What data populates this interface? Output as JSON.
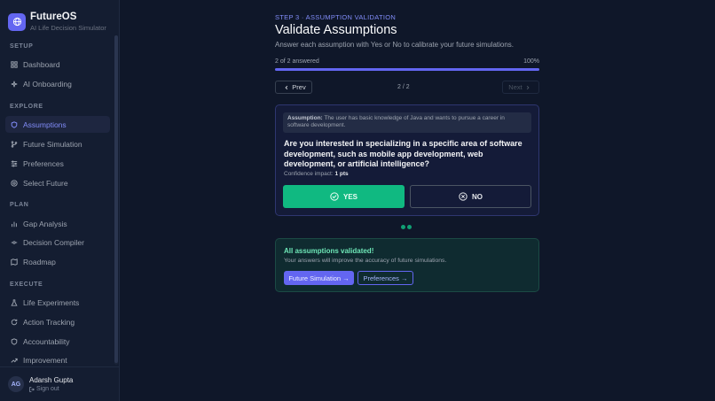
{
  "brand": {
    "name": "FutureOS",
    "subtitle": "AI Life Decision Simulator"
  },
  "sidebar": {
    "sections": [
      {
        "label": "SETUP",
        "items": [
          {
            "label": "Dashboard",
            "icon": "grid-icon"
          },
          {
            "label": "AI Onboarding",
            "icon": "sparkle-icon"
          }
        ]
      },
      {
        "label": "EXPLORE",
        "items": [
          {
            "label": "Assumptions",
            "icon": "shield-icon",
            "active": true
          },
          {
            "label": "Future Simulation",
            "icon": "branch-icon"
          },
          {
            "label": "Preferences",
            "icon": "sliders-icon"
          },
          {
            "label": "Select Future",
            "icon": "target-icon"
          }
        ]
      },
      {
        "label": "PLAN",
        "items": [
          {
            "label": "Gap Analysis",
            "icon": "bar-chart-icon"
          },
          {
            "label": "Decision Compiler",
            "icon": "compiler-icon"
          },
          {
            "label": "Roadmap",
            "icon": "map-icon"
          }
        ]
      },
      {
        "label": "EXECUTE",
        "items": [
          {
            "label": "Life Experiments",
            "icon": "flask-icon"
          },
          {
            "label": "Action Tracking",
            "icon": "refresh-icon"
          },
          {
            "label": "Accountability",
            "icon": "shield-outline-icon"
          },
          {
            "label": "Improvement",
            "icon": "trend-up-icon"
          }
        ]
      }
    ]
  },
  "user": {
    "initials": "AG",
    "name": "Adarsh Gupta",
    "signout": "Sign out"
  },
  "main": {
    "step": "STEP 3 · ASSUMPTION VALIDATION",
    "title": "Validate Assumptions",
    "subtitle": "Answer each assumption with Yes or No to calibrate your future simulations.",
    "progress": {
      "label": "2 of 2 answered",
      "percent_label": "100%",
      "fraction": 1.0
    },
    "nav": {
      "prev": "Prev",
      "page": "2 / 2",
      "next": "Next"
    },
    "card": {
      "assumption_label": "Assumption:",
      "assumption_text": "The user has basic knowledge of Java and wants to pursue a career in software development.",
      "question": "Are you interested in specializing in a specific area of software development, such as mobile app development, web development, or artificial intelligence?",
      "impact_label": "Confidence impact:",
      "impact_value": "1 pts",
      "yes": "YES",
      "no": "NO"
    },
    "done": {
      "title": "All assumptions validated!",
      "desc": "Your answers will improve the accuracy of future simulations.",
      "btn_sim": "Future Simulation →",
      "btn_pref": "Preferences →"
    }
  },
  "colors": {
    "accent": "#6366f1",
    "success": "#10b981",
    "background": "#0f1729"
  }
}
